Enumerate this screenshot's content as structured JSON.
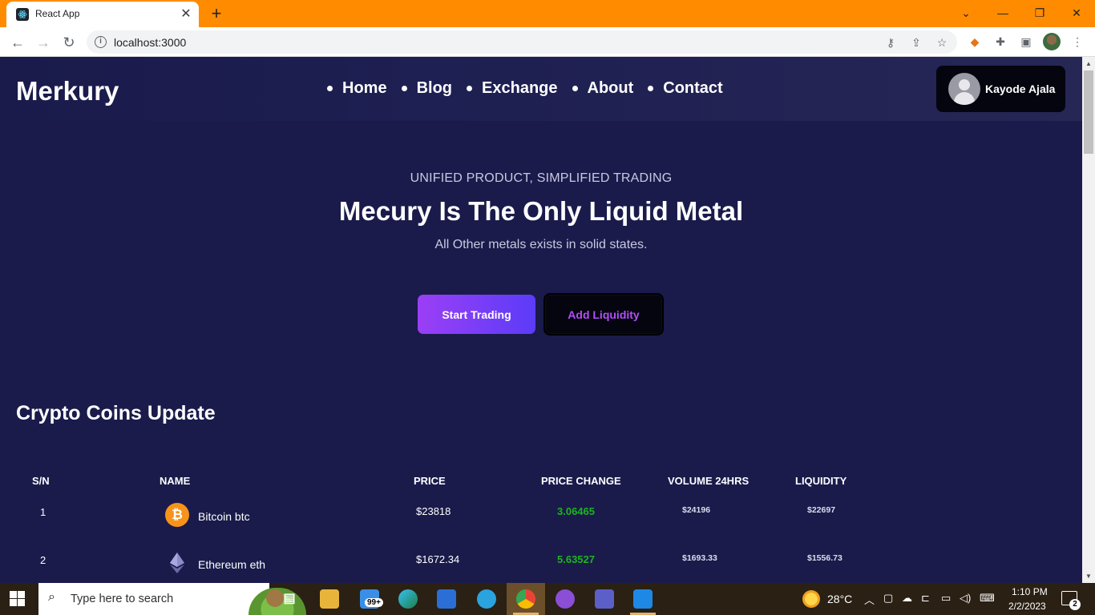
{
  "browser": {
    "tab_title": "React App",
    "tab_close": "✕",
    "new_tab": "+",
    "url": "localhost:3000",
    "window_controls": [
      "⌄",
      "—",
      "❐",
      "✕"
    ]
  },
  "site": {
    "logo": "Merkury",
    "nav": [
      {
        "label": "Home"
      },
      {
        "label": "Blog"
      },
      {
        "label": "Exchange"
      },
      {
        "label": "About"
      },
      {
        "label": "Contact"
      }
    ],
    "user_name": "Kayode Ajala"
  },
  "hero": {
    "eyebrow": "UNIFIED PRODUCT, SIMPLIFIED TRADING",
    "title": "Mecury Is The Only Liquid Metal",
    "subtitle": "All Other metals exists in solid states.",
    "primary_button": "Start Trading",
    "secondary_button": "Add Liquidity"
  },
  "coins": {
    "title": "Crypto Coins Update",
    "headers": [
      "S/N",
      "NAME",
      "PRICE",
      "PRICE CHANGE",
      "VOLUME 24HRS",
      "LIQUIDITY"
    ],
    "rows": [
      {
        "sn": "1",
        "name": "Bitcoin btc",
        "price": "$23818",
        "change": "3.06465",
        "volume": "$24196",
        "liquidity": "$22697",
        "icon": "bitcoin-icon"
      },
      {
        "sn": "2",
        "name": "Ethereum eth",
        "price": "$1672.34",
        "change": "5.63527",
        "volume": "$1693.33",
        "liquidity": "$1556.73",
        "icon": "ethereum-icon"
      }
    ],
    "change_color": "#1db41d"
  },
  "taskbar": {
    "search_placeholder": "Type here to search",
    "mail_badge": "99+",
    "temperature": "28°C",
    "time": "1:10 PM",
    "date": "2/2/2023",
    "notification_count": "2"
  },
  "colors": {
    "tab_bar": "#ff8c00",
    "page_bg": "#1a1b4b",
    "accent_gradient_start": "#9b3ff5",
    "accent_gradient_end": "#5b3cf8",
    "add_liquidity_text": "#b44ef7"
  }
}
